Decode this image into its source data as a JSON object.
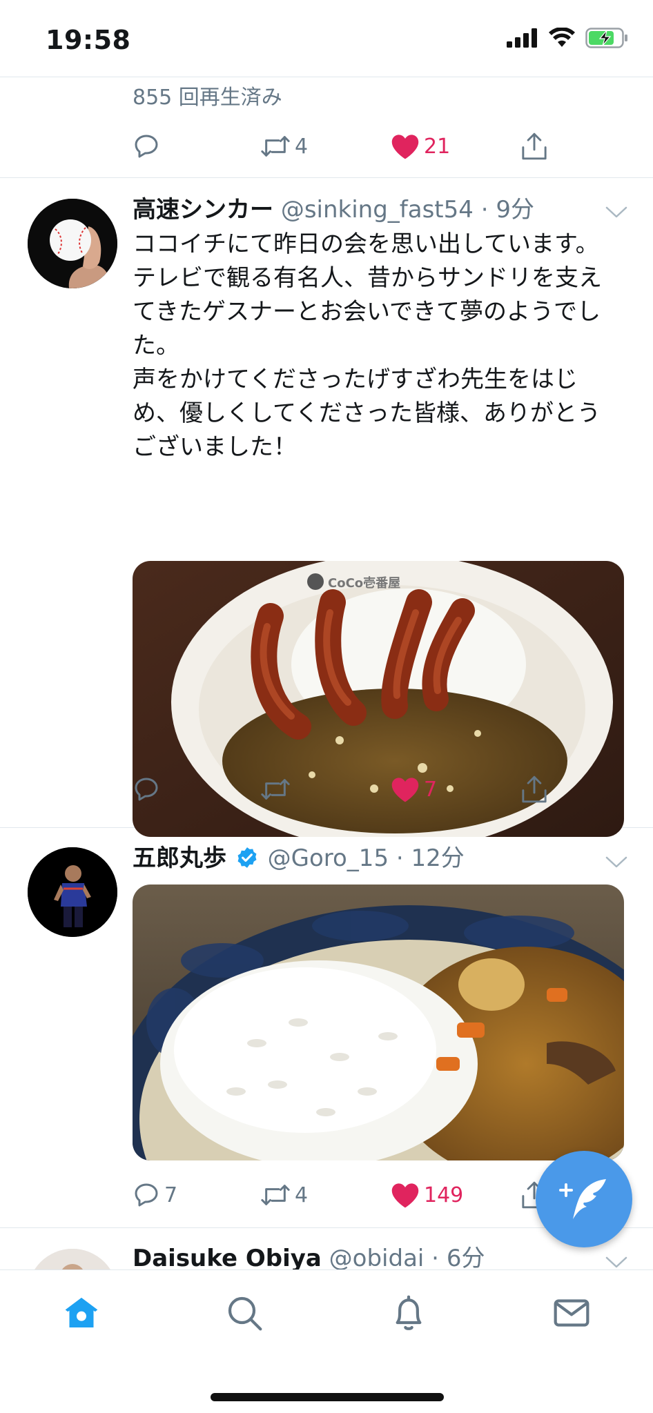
{
  "status_bar": {
    "time": "19:58"
  },
  "tweets": [
    {
      "views_text": "855 回再生済み",
      "reply_count": "",
      "retweet_count": "4",
      "like_count": "21"
    },
    {
      "display_name": "高速シンカー",
      "handle": "@sinking_fast54",
      "time": "9分",
      "text": "ココイチにて昨日の会を思い出しています。\nテレビで観る有名人、昔からサンドリを支え\nてきたゲスナーとお会いできて夢のようでし\nた。\n声をかけてくださったげすざわ先生をはじ\nめ、優しくしてくださった皆様、ありがとう\nございました！",
      "media_logo_text": "CoCo壱番屋",
      "reply_count": "",
      "retweet_count": "",
      "like_count": "7"
    },
    {
      "display_name": "五郎丸歩",
      "verified": true,
      "handle": "@Goro_15",
      "time": "12分",
      "reply_count": "7",
      "retweet_count": "4",
      "like_count": "149"
    },
    {
      "display_name": "Daisuke Obiya",
      "handle": "@obidai",
      "time": "6分"
    }
  ],
  "separator": " · ",
  "colors": {
    "accent": "#1da1f2",
    "like": "#e0245e",
    "muted": "#657786",
    "fab": "#4a99e9"
  },
  "tab_bar": [
    "home-icon",
    "search-icon",
    "bell-icon",
    "mail-icon"
  ]
}
